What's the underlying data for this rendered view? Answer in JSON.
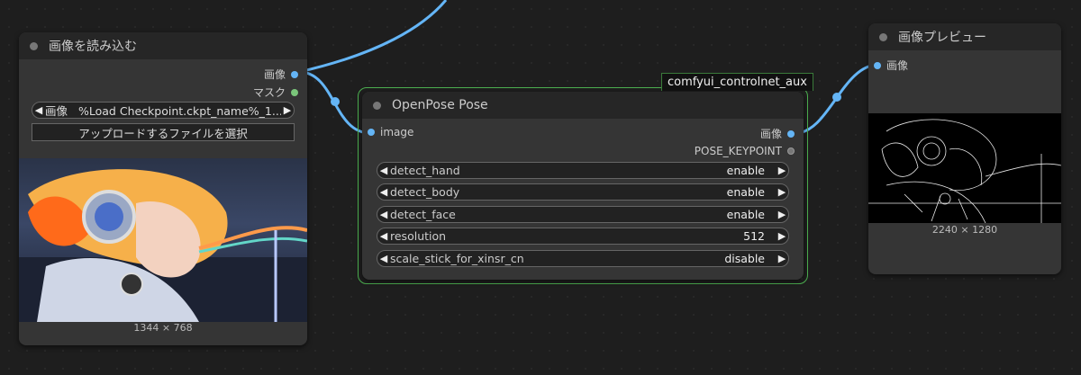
{
  "load_node": {
    "title": "画像を読み込む",
    "outputs": [
      {
        "label": "画像"
      },
      {
        "label": "マスク"
      }
    ],
    "image_widget": {
      "name": "画像",
      "value": "%Load Checkpoint.ckpt_name%_1..."
    },
    "upload_button": "アップロードするファイルを選択",
    "dimensions": "1344 × 768"
  },
  "openpose_node": {
    "group_label": "comfyui_controlnet_aux",
    "title": "OpenPose Pose",
    "input": "image",
    "outputs": [
      "画像",
      "POSE_KEYPOINT"
    ],
    "widgets": [
      {
        "name": "detect_hand",
        "value": "enable"
      },
      {
        "name": "detect_body",
        "value": "enable"
      },
      {
        "name": "detect_face",
        "value": "enable"
      },
      {
        "name": "resolution",
        "value": "512"
      },
      {
        "name": "scale_stick_for_xinsr_cn",
        "value": "disable"
      }
    ]
  },
  "preview_node": {
    "title": "画像プレビュー",
    "input": "画像",
    "dimensions": "2240 × 1280"
  },
  "colors": {
    "link_blue": "#64b5f6",
    "group_border": "#4caf50",
    "node_bg": "#353535"
  }
}
